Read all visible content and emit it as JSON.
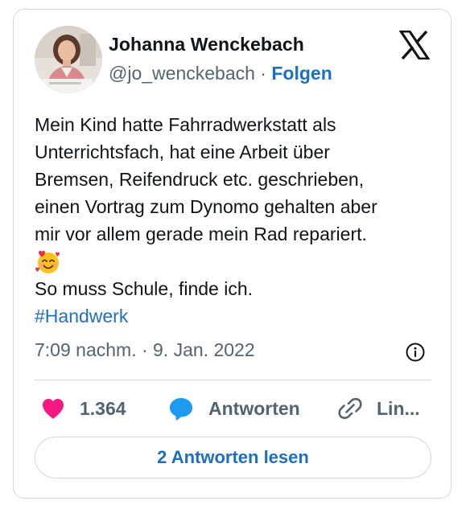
{
  "author": {
    "name": "Johanna Wenckebach",
    "handle": "@jo_wenckebach",
    "separator": " · ",
    "follow_label": "Folgen"
  },
  "tweet": {
    "lines": [
      "Mein Kind hatte Fahrradwerkstatt als",
      "Unterrichtsfach, hat eine Arbeit über",
      "Bremsen, Reifendruck etc. geschrieben,",
      "einen Vortrag zum Dynomo gehalten aber",
      "mir vor allem gerade mein Rad repariert."
    ],
    "emoji": "smiling-face-with-hearts",
    "closing_line": "So muss Schule, finde ich.",
    "hashtag": "#Handwerk"
  },
  "timestamp": "7:09 nachm. · 9. Jan. 2022",
  "actions": {
    "like_count": "1.364",
    "reply_label": "Antworten",
    "link_label": "Lin..."
  },
  "read_replies_label": "2 Antworten lesen",
  "icons": {
    "x_logo": "x-logo-icon",
    "info": "info-icon",
    "like": "heart-icon",
    "reply": "speech-bubble-icon",
    "link": "link-icon"
  },
  "colors": {
    "link_blue": "#1d6fc4",
    "heart_pink": "#f91880",
    "reply_blue": "#1d9bf0",
    "muted_gray": "#536471",
    "border": "#cfd9de"
  }
}
